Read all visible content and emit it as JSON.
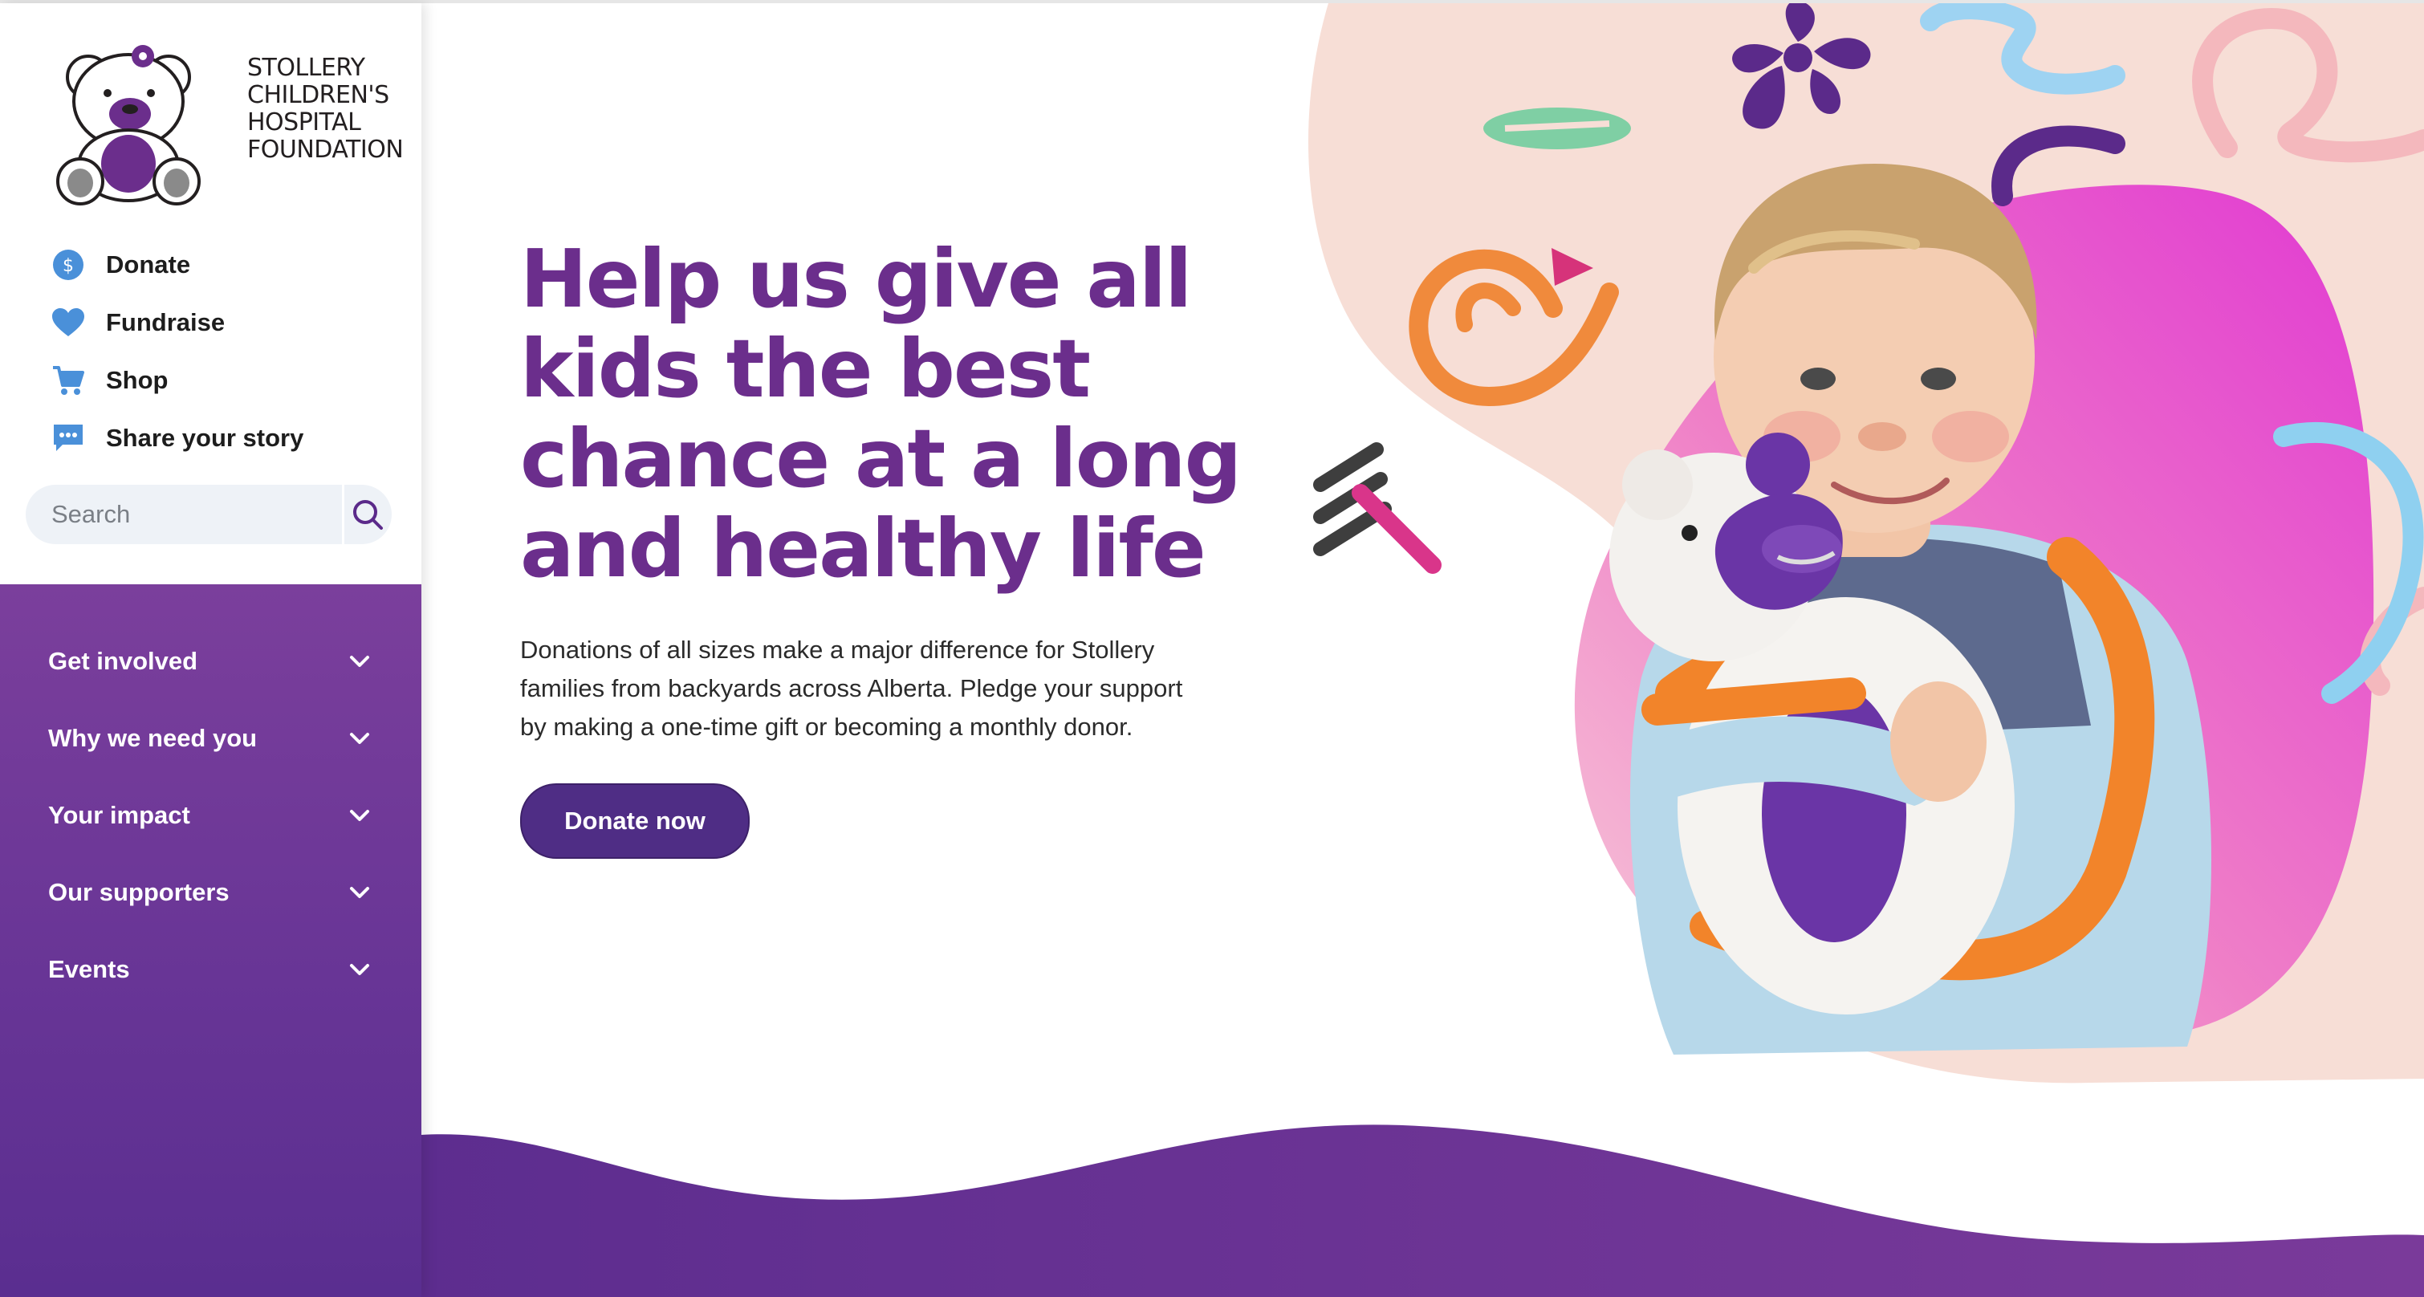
{
  "brand": {
    "name_lines": [
      "STOLLERY",
      "CHILDREN'S",
      "HOSPITAL",
      "FOUNDATION"
    ],
    "primary_color": "#6b2e8c",
    "button_color": "#4f2d85"
  },
  "quick_nav": [
    {
      "label": "Donate",
      "icon": "dollar-circle-icon"
    },
    {
      "label": "Fundraise",
      "icon": "heart-icon"
    },
    {
      "label": "Shop",
      "icon": "cart-icon"
    },
    {
      "label": "Share your story",
      "icon": "chat-bubble-icon"
    }
  ],
  "search": {
    "placeholder": "Search",
    "icon": "search-icon"
  },
  "main_nav": [
    {
      "label": "Get involved",
      "icon": "chevron-down-icon"
    },
    {
      "label": "Why we need you",
      "icon": "chevron-down-icon"
    },
    {
      "label": "Your impact",
      "icon": "chevron-down-icon"
    },
    {
      "label": "Our supporters",
      "icon": "chevron-down-icon"
    },
    {
      "label": "Events",
      "icon": "chevron-down-icon"
    }
  ],
  "hero": {
    "headline_lines": [
      "Help us give all",
      "kids the best",
      "chance at a long",
      "and healthy life"
    ],
    "body_lines": [
      "Donations of all sizes make a major difference for Stollery",
      "families from backyards across Alberta. Pledge your support",
      "by making a one-time gift or becoming a monthly donor."
    ],
    "cta_label": "Donate now"
  }
}
